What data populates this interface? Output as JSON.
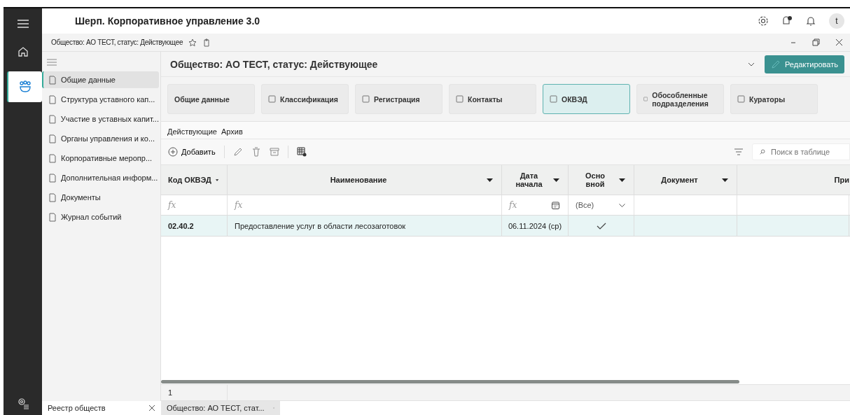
{
  "window": {
    "title": "Шерп. Корпоративное управление 3.0",
    "avatar": "t"
  },
  "breadcrumb": {
    "text": "Общество: АО ТЕСТ, статус: Действующее"
  },
  "sidebar": {
    "items": [
      {
        "label": "Общие данные",
        "selected": true
      },
      {
        "label": "Структура уставного кап...",
        "selected": false
      },
      {
        "label": "Участие в уставных капит...",
        "selected": false
      },
      {
        "label": "Органы управления и ко...",
        "selected": false
      },
      {
        "label": "Корпоративные меропр...",
        "selected": false
      },
      {
        "label": "Дополнительная информ...",
        "selected": false
      },
      {
        "label": "Документы",
        "selected": false
      },
      {
        "label": "Журнал событий",
        "selected": false
      }
    ]
  },
  "main": {
    "title": "Общество: АО ТЕСТ, статус: Действующее",
    "edit_button": "Редактировать"
  },
  "card_tabs": [
    {
      "label": "Общие данные",
      "selected": false
    },
    {
      "label": "Классификация",
      "selected": false
    },
    {
      "label": "Регистрация",
      "selected": false
    },
    {
      "label": "Контакты",
      "selected": false
    },
    {
      "label": "ОКВЭД",
      "selected": true
    },
    {
      "label": "Обособленные подразделения",
      "selected": false
    },
    {
      "label": "Кураторы",
      "selected": false
    }
  ],
  "sub_tabs": [
    {
      "label": "Действующие",
      "selected": true
    },
    {
      "label": "Архив",
      "selected": false
    }
  ],
  "toolbar": {
    "add": "Добавить",
    "search_placeholder": "Поиск в таблице"
  },
  "table": {
    "columns": [
      {
        "label": "Код ОКВЭД"
      },
      {
        "label": "Наименование"
      },
      {
        "label": "Дата начала"
      },
      {
        "label": "Осно вной"
      },
      {
        "label": "Документ"
      },
      {
        "label": "При"
      }
    ],
    "filters": [
      {
        "kind": "formula",
        "symbol": "fx"
      },
      {
        "kind": "formula",
        "symbol": "fx"
      },
      {
        "kind": "date",
        "symbol": "fx"
      },
      {
        "kind": "select",
        "value": "(Все)"
      },
      {
        "kind": "empty"
      },
      {
        "kind": "empty"
      }
    ],
    "rows": [
      {
        "code": "02.40.2",
        "name": "Предоставление услуг в области лесозаготовок",
        "start": "06.11.2024 (ср)",
        "main": true
      }
    ],
    "footer": "1"
  },
  "bottom_tabs": [
    {
      "label": "Реестр обществ",
      "selected": false
    },
    {
      "label": "Общество: АО ТЕСТ, стат...",
      "selected": true
    }
  ]
}
